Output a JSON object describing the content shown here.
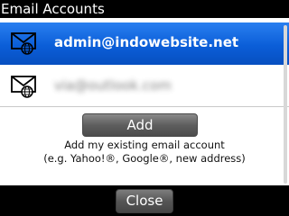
{
  "window": {
    "title": "Email Accounts"
  },
  "accounts": [
    {
      "email": "admin@indowebsite.net",
      "icon": "envelope-globe-icon",
      "selected": true
    },
    {
      "email": "via@outlook.com",
      "icon": "envelope-globe-icon",
      "selected": false,
      "blurred": true
    }
  ],
  "add": {
    "button_label": "Add",
    "description_line1": "Add my existing email account",
    "description_line2": "(e.g. Yahoo!®, Google®, new address)"
  },
  "footer": {
    "close_label": "Close"
  },
  "colors": {
    "selection": "#0b5ed8",
    "title_background": "#000000",
    "panel_background": "#ffffff",
    "button_gray": "#5e5e5e"
  }
}
